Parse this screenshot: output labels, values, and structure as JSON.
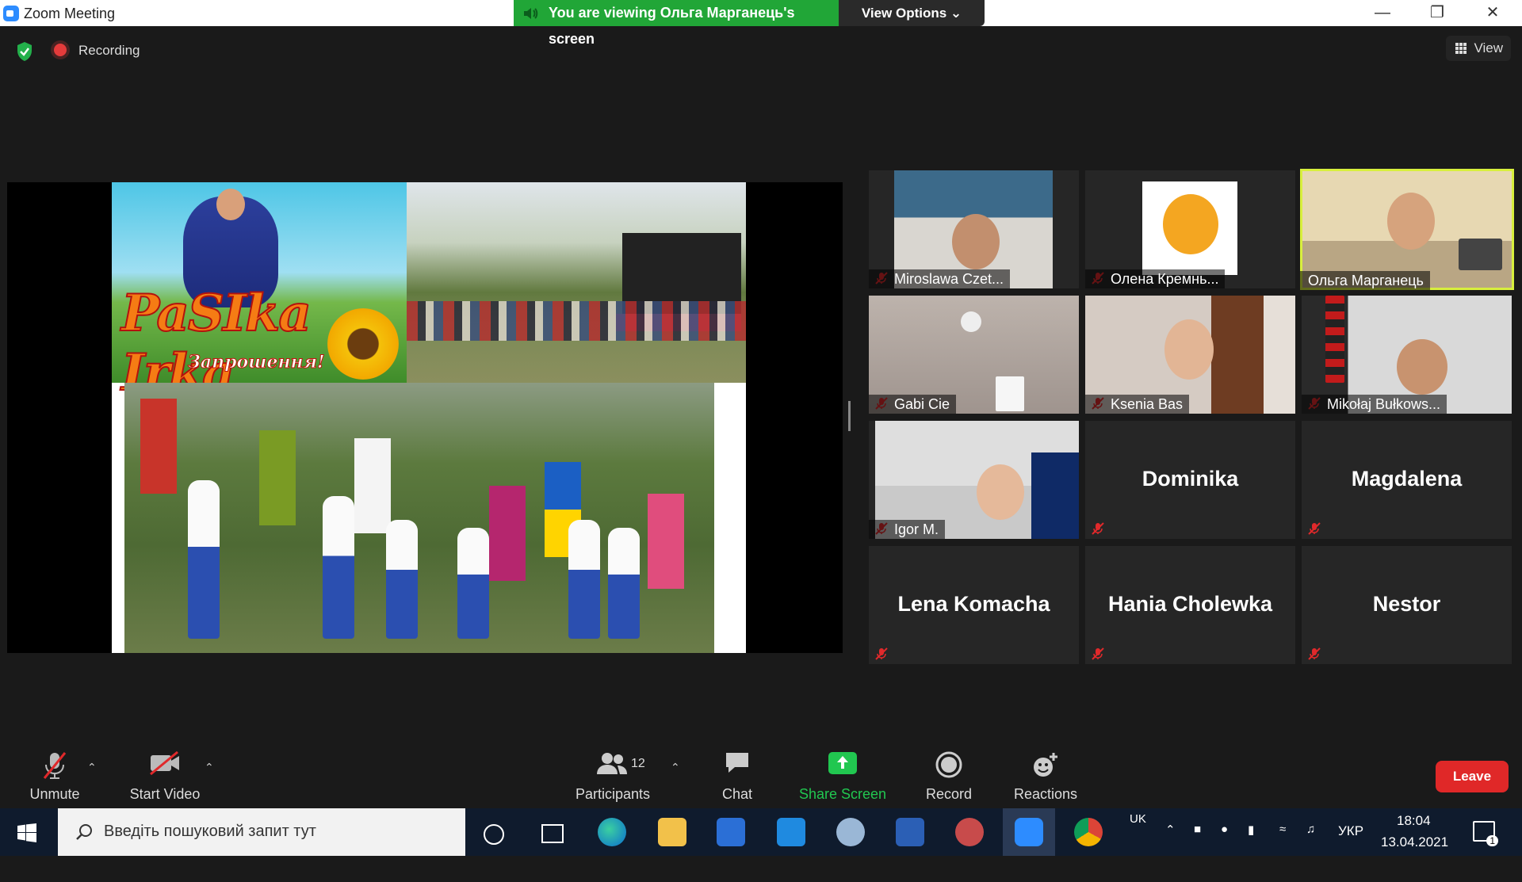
{
  "window": {
    "title": "Zoom Meeting"
  },
  "banner": {
    "viewing": "You are viewing Ольга Марганець's screen",
    "view_options": "View Options"
  },
  "status": {
    "recording": "Recording",
    "view": "View"
  },
  "shared": {
    "logo_text": "PaSIka Irka",
    "logo_subtitle": "Запрошення!"
  },
  "participants_grid": [
    {
      "name": "Miroslawa Czet..."
    },
    {
      "name": "Олена Кремнь..."
    },
    {
      "name": "Ольга Марганець",
      "active_speaker": true
    },
    {
      "name": "Gabi Cie"
    },
    {
      "name": "Ksenia Bas"
    },
    {
      "name": "Mikołaj Bułkows..."
    },
    {
      "name": "Igor M."
    },
    {
      "name": "Dominika"
    },
    {
      "name": "Magdalena"
    },
    {
      "name": "Lena Komacha"
    },
    {
      "name": "Hania Cholewka"
    },
    {
      "name": "Nestor"
    }
  ],
  "controls": {
    "unmute": "Unmute",
    "start_video": "Start Video",
    "participants": "Participants",
    "participants_count": "12",
    "chat": "Chat",
    "share_screen": "Share Screen",
    "record": "Record",
    "reactions": "Reactions",
    "leave": "Leave"
  },
  "taskbar": {
    "search_placeholder": "Введіть пошуковий запит тут",
    "lang_indicator": "UK",
    "keyboard_lang": "УКР",
    "time": "18:04",
    "date": "13.04.2021",
    "notifications": "1"
  },
  "colors": {
    "banner_green": "#21a637",
    "share_green": "#21c750",
    "leave_red": "#e02828",
    "active_border": "#d8ef3d"
  }
}
